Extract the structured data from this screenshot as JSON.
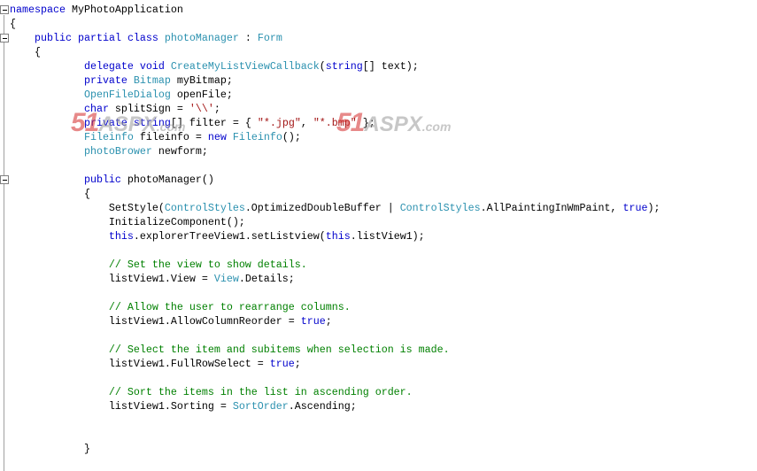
{
  "editor": {
    "lines": [
      [
        [
          "namespace",
          "k"
        ],
        [
          " MyPhotoApplication",
          "p"
        ]
      ],
      [
        [
          "{",
          "p"
        ]
      ],
      [
        [
          "    ",
          "p"
        ],
        [
          "public",
          "k"
        ],
        [
          " ",
          "p"
        ],
        [
          "partial",
          "k"
        ],
        [
          " ",
          "p"
        ],
        [
          "class",
          "k"
        ],
        [
          " ",
          "p"
        ],
        [
          "photoManager",
          "t"
        ],
        [
          " : ",
          "p"
        ],
        [
          "Form",
          "t"
        ]
      ],
      [
        [
          "    {",
          "p"
        ]
      ],
      [
        [
          "            ",
          "p"
        ],
        [
          "delegate",
          "k"
        ],
        [
          " ",
          "p"
        ],
        [
          "void",
          "k"
        ],
        [
          " ",
          "p"
        ],
        [
          "CreateMyListViewCallback",
          "t"
        ],
        [
          "(",
          "p"
        ],
        [
          "string",
          "k"
        ],
        [
          "[] text);",
          "p"
        ]
      ],
      [
        [
          "            ",
          "p"
        ],
        [
          "private",
          "k"
        ],
        [
          " ",
          "p"
        ],
        [
          "Bitmap",
          "t"
        ],
        [
          " myBitmap;",
          "p"
        ]
      ],
      [
        [
          "            ",
          "p"
        ],
        [
          "OpenFileDialog",
          "t"
        ],
        [
          " openFile;",
          "p"
        ]
      ],
      [
        [
          "            ",
          "p"
        ],
        [
          "char",
          "k"
        ],
        [
          " splitSign = ",
          "p"
        ],
        [
          "'\\\\'",
          "s"
        ],
        [
          ";",
          "p"
        ]
      ],
      [
        [
          "            ",
          "p"
        ],
        [
          "private",
          "k"
        ],
        [
          " ",
          "p"
        ],
        [
          "string",
          "k"
        ],
        [
          "[] filter = { ",
          "p"
        ],
        [
          "\"*.jpg\"",
          "s"
        ],
        [
          ", ",
          "p"
        ],
        [
          "\"*.bmp\"",
          "s"
        ],
        [
          " };",
          "p"
        ]
      ],
      [
        [
          "            ",
          "p"
        ],
        [
          "Fileinfo",
          "t"
        ],
        [
          " fileinfo = ",
          "p"
        ],
        [
          "new",
          "k"
        ],
        [
          " ",
          "p"
        ],
        [
          "Fileinfo",
          "t"
        ],
        [
          "();",
          "p"
        ]
      ],
      [
        [
          "            ",
          "p"
        ],
        [
          "photoBrower",
          "t"
        ],
        [
          " newform;",
          "p"
        ]
      ],
      [],
      [
        [
          "            ",
          "p"
        ],
        [
          "public",
          "k"
        ],
        [
          " photoManager()",
          "p"
        ]
      ],
      [
        [
          "            {",
          "p"
        ]
      ],
      [
        [
          "                SetStyle(",
          "p"
        ],
        [
          "ControlStyles",
          "t"
        ],
        [
          ".OptimizedDoubleBuffer | ",
          "p"
        ],
        [
          "ControlStyles",
          "t"
        ],
        [
          ".AllPaintingInWmPaint, ",
          "p"
        ],
        [
          "true",
          "k"
        ],
        [
          ");",
          "p"
        ]
      ],
      [
        [
          "                InitializeComponent();",
          "p"
        ]
      ],
      [
        [
          "                ",
          "p"
        ],
        [
          "this",
          "k"
        ],
        [
          ".explorerTreeView1.setListview(",
          "p"
        ],
        [
          "this",
          "k"
        ],
        [
          ".listView1);",
          "p"
        ]
      ],
      [],
      [
        [
          "                ",
          "p"
        ],
        [
          "// Set the view to show details.",
          "c"
        ]
      ],
      [
        [
          "                listView1.View = ",
          "p"
        ],
        [
          "View",
          "t"
        ],
        [
          ".Details;",
          "p"
        ]
      ],
      [],
      [
        [
          "                ",
          "p"
        ],
        [
          "// Allow the user to rearrange columns.",
          "c"
        ]
      ],
      [
        [
          "                listView1.AllowColumnReorder = ",
          "p"
        ],
        [
          "true",
          "k"
        ],
        [
          ";",
          "p"
        ]
      ],
      [],
      [
        [
          "                ",
          "p"
        ],
        [
          "// Select the item and subitems when selection is made.",
          "c"
        ]
      ],
      [
        [
          "                listView1.FullRowSelect = ",
          "p"
        ],
        [
          "true",
          "k"
        ],
        [
          ";",
          "p"
        ]
      ],
      [],
      [
        [
          "                ",
          "p"
        ],
        [
          "// Sort the items in the list in ascending order.",
          "c"
        ]
      ],
      [
        [
          "                listView1.Sorting = ",
          "p"
        ],
        [
          "SortOrder",
          "t"
        ],
        [
          ".Ascending;",
          "p"
        ]
      ],
      [],
      [],
      [
        [
          "            }",
          "p"
        ]
      ]
    ]
  },
  "watermark": {
    "brand_number": "51",
    "brand_name": "ASPX",
    "brand_domain": ".com"
  },
  "colors": {
    "keyword": "#0000cc",
    "type": "#2b91af",
    "string": "#a31515",
    "comment": "#008000"
  }
}
